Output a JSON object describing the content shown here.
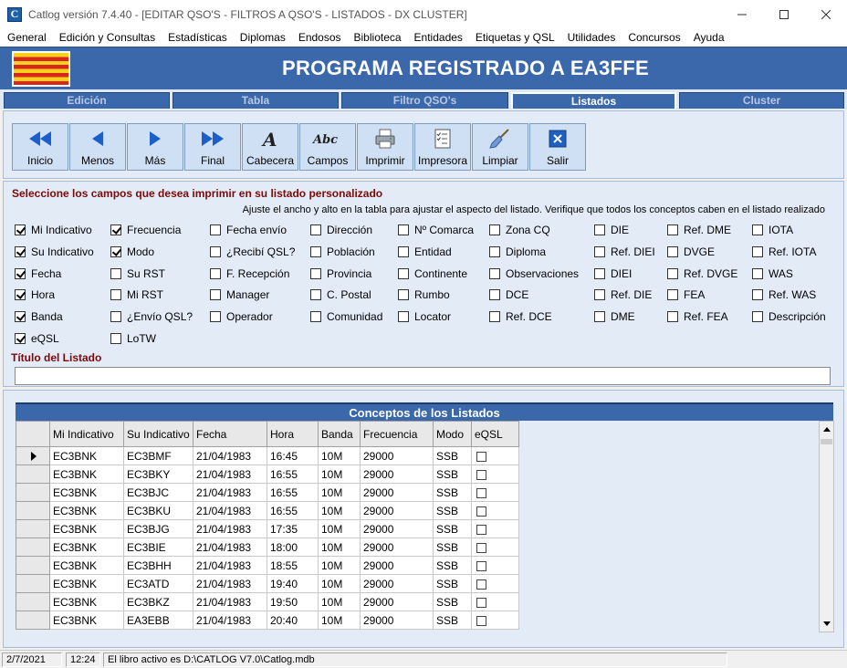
{
  "window": {
    "title": "Catlog versión 7.4.40 - [EDITAR QSO'S  - FILTROS A QSO'S - LISTADOS -  DX CLUSTER]",
    "icon_letter": "C"
  },
  "menu": [
    "General",
    "Edición y Consultas",
    "Estadísticas",
    "Diplomas",
    "Endosos",
    "Biblioteca",
    "Entidades",
    "Etiquetas y QSL",
    "Utilidades",
    "Concursos",
    "Ayuda"
  ],
  "banner": {
    "title": "PROGRAMA REGISTRADO A EA3FFE"
  },
  "tabs": [
    "Edición",
    "Tabla",
    "Filtro QSO's",
    "Listados",
    "Cluster"
  ],
  "toolbar": [
    {
      "label": "Inicio",
      "icon": "first-icon"
    },
    {
      "label": "Menos",
      "icon": "prev-icon"
    },
    {
      "label": "Más",
      "icon": "next-icon"
    },
    {
      "label": "Final",
      "icon": "last-icon"
    },
    {
      "label": "Cabecera",
      "icon": "header-icon"
    },
    {
      "label": "Campos",
      "icon": "fields-icon"
    },
    {
      "label": "Imprimir",
      "icon": "printer-icon"
    },
    {
      "label": "Impresora",
      "icon": "checklist-icon"
    },
    {
      "label": "Limpiar",
      "icon": "broom-icon"
    },
    {
      "label": "Salir",
      "icon": "close-icon"
    }
  ],
  "fields": {
    "heading": "Seleccione los campos que desea imprimir en su listado personalizado",
    "hint": "Ajuste el ancho y alto en la tabla para ajustar el aspecto del listado. Verifique que todos los conceptos caben en el listado realizado",
    "columns": [
      [
        {
          "label": "Mi Indicativo",
          "checked": true
        },
        {
          "label": "Su Indicativo",
          "checked": true
        },
        {
          "label": "Fecha",
          "checked": true
        },
        {
          "label": "Hora",
          "checked": true
        },
        {
          "label": "Banda",
          "checked": true
        },
        {
          "label": "eQSL",
          "checked": true
        }
      ],
      [
        {
          "label": "Frecuencia",
          "checked": true
        },
        {
          "label": "Modo",
          "checked": true
        },
        {
          "label": "Su RST",
          "checked": false
        },
        {
          "label": "Mi RST",
          "checked": false
        },
        {
          "label": "¿Envío QSL?",
          "checked": false
        },
        {
          "label": "LoTW",
          "checked": false
        }
      ],
      [
        {
          "label": "Fecha envío",
          "checked": false
        },
        {
          "label": "¿Recibí QSL?",
          "checked": false
        },
        {
          "label": "F. Recepción",
          "checked": false
        },
        {
          "label": "Manager",
          "checked": false
        },
        {
          "label": "Operador",
          "checked": false
        }
      ],
      [
        {
          "label": "Dirección",
          "checked": false
        },
        {
          "label": "Población",
          "checked": false
        },
        {
          "label": "Provincia",
          "checked": false
        },
        {
          "label": "C. Postal",
          "checked": false
        },
        {
          "label": "Comunidad",
          "checked": false
        }
      ],
      [
        {
          "label": "Nº Comarca",
          "checked": false
        },
        {
          "label": "Entidad",
          "checked": false
        },
        {
          "label": "Continente",
          "checked": false
        },
        {
          "label": "Rumbo",
          "checked": false
        },
        {
          "label": "Locator",
          "checked": false
        }
      ],
      [
        {
          "label": "Zona CQ",
          "checked": false
        },
        {
          "label": "Diploma",
          "checked": false
        },
        {
          "label": "Observaciones",
          "checked": false
        },
        {
          "label": "DCE",
          "checked": false
        },
        {
          "label": "Ref. DCE",
          "checked": false
        }
      ],
      [
        {
          "label": "DIE",
          "checked": false
        },
        {
          "label": "Ref. DIEI",
          "checked": false
        },
        {
          "label": "DIEI",
          "checked": false
        },
        {
          "label": "Ref. DIE",
          "checked": false
        },
        {
          "label": "DME",
          "checked": false
        }
      ],
      [
        {
          "label": "Ref. DME",
          "checked": false
        },
        {
          "label": "DVGE",
          "checked": false
        },
        {
          "label": "Ref. DVGE",
          "checked": false
        },
        {
          "label": "FEA",
          "checked": false
        },
        {
          "label": "Ref. FEA",
          "checked": false
        }
      ],
      [
        {
          "label": "IOTA",
          "checked": false
        },
        {
          "label": "Ref. IOTA",
          "checked": false
        },
        {
          "label": "WAS",
          "checked": false
        },
        {
          "label": "Ref. WAS",
          "checked": false
        },
        {
          "label": "Descripción",
          "checked": false
        }
      ]
    ],
    "titulo_label": "Título del Listado",
    "titulo_value": ""
  },
  "grid": {
    "title": "Conceptos de los Listados",
    "headers": [
      "Mi Indicativo",
      "Su Indicativo",
      "Fecha",
      "Hora",
      "Banda",
      "Frecuencia",
      "Modo",
      "eQSL"
    ],
    "rows": [
      [
        "EC3BNK",
        "EC3BMF",
        "21/04/1983",
        "16:45",
        "10M",
        "29000",
        "SSB"
      ],
      [
        "EC3BNK",
        "EC3BKY",
        "21/04/1983",
        "16:55",
        "10M",
        "29000",
        "SSB"
      ],
      [
        "EC3BNK",
        "EC3BJC",
        "21/04/1983",
        "16:55",
        "10M",
        "29000",
        "SSB"
      ],
      [
        "EC3BNK",
        "EC3BKU",
        "21/04/1983",
        "16:55",
        "10M",
        "29000",
        "SSB"
      ],
      [
        "EC3BNK",
        "EC3BJG",
        "21/04/1983",
        "17:35",
        "10M",
        "29000",
        "SSB"
      ],
      [
        "EC3BNK",
        "EC3BIE",
        "21/04/1983",
        "18:00",
        "10M",
        "29000",
        "SSB"
      ],
      [
        "EC3BNK",
        "EC3BHH",
        "21/04/1983",
        "18:55",
        "10M",
        "29000",
        "SSB"
      ],
      [
        "EC3BNK",
        "EC3ATD",
        "21/04/1983",
        "19:40",
        "10M",
        "29000",
        "SSB"
      ],
      [
        "EC3BNK",
        "EC3BKZ",
        "21/04/1983",
        "19:50",
        "10M",
        "29000",
        "SSB"
      ],
      [
        "EC3BNK",
        "EA3EBB",
        "21/04/1983",
        "20:40",
        "10M",
        "29000",
        "SSB"
      ]
    ]
  },
  "status": {
    "date": "2/7/2021",
    "time": "12:24",
    "message": "El libro activo es D:\\CATLOG V7.0\\Catlog.mdb"
  },
  "colors": {
    "banner": "#3b67ab",
    "panel": "#e3ebf6",
    "heading": "#7a0a0a",
    "flag_yellow": "#f7d11b",
    "flag_red": "#d9251d"
  }
}
